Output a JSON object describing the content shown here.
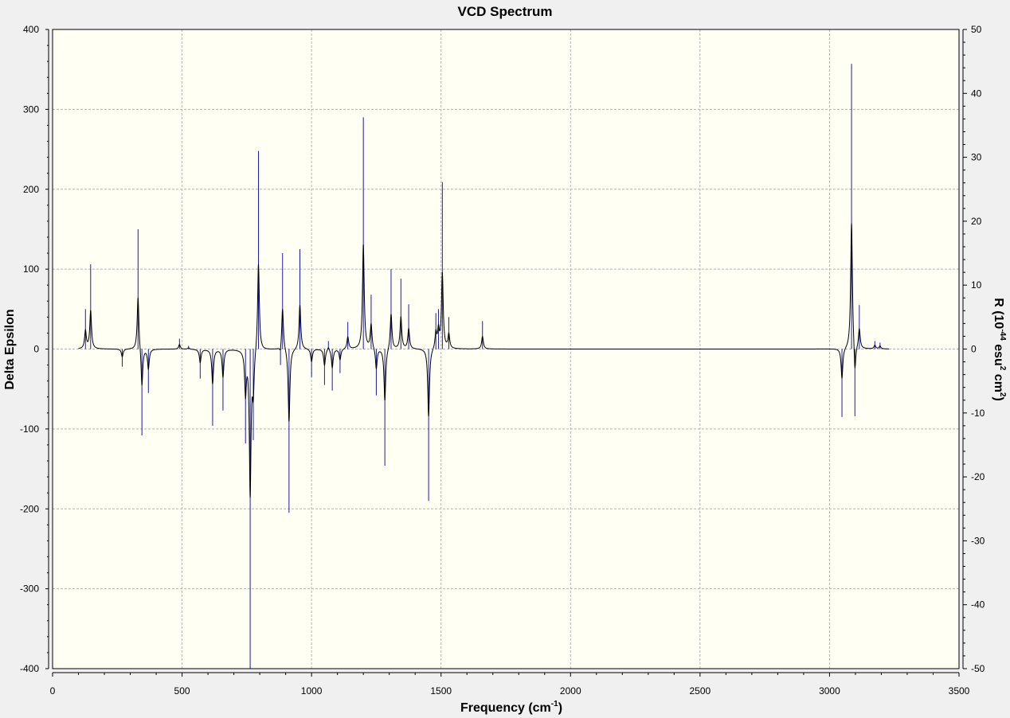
{
  "chart_data": {
    "type": "line",
    "title": "VCD Spectrum",
    "xlabel": {
      "main": "Frequency (cm",
      "sup": "-1",
      "tail": ")"
    },
    "ylabel_left": "Delta Epsilon",
    "ylabel_right": {
      "parts": [
        {
          "text": "R (10",
          "sup": false
        },
        {
          "text": "-44",
          "sup": true
        },
        {
          "text": " esu",
          "sup": false
        },
        {
          "text": "2",
          "sup": true
        },
        {
          "text": " cm",
          "sup": false
        },
        {
          "text": "2",
          "sup": true
        },
        {
          "text": ")",
          "sup": false
        }
      ]
    },
    "xlim": [
      0,
      3500
    ],
    "ylim_left": [
      -400,
      400
    ],
    "ylim_right": [
      -50,
      50
    ],
    "x_ticks": [
      0,
      500,
      1000,
      1500,
      2000,
      2500,
      3000,
      3500
    ],
    "y_ticks_left": [
      -400,
      -300,
      -200,
      -100,
      0,
      100,
      200,
      300,
      400
    ],
    "y_ticks_right": [
      -50,
      -40,
      -30,
      -20,
      -10,
      0,
      10,
      20,
      30,
      40,
      50
    ],
    "grid": true,
    "colors": {
      "plot_bg": "#fffff4",
      "grid": "#b4b4b4",
      "curve": "#000000",
      "sticks": "#1c1caa",
      "frame": "#000000"
    },
    "curve_range": [
      100,
      3230
    ],
    "curve_hwhm": 4,
    "series": [
      {
        "name": "",
        "kind": "sticks",
        "points": [
          [
            127,
            50
          ],
          [
            147,
            106
          ],
          [
            269,
            -22
          ],
          [
            330,
            150
          ],
          [
            345,
            -108
          ],
          [
            370,
            -55
          ],
          [
            490,
            13
          ],
          [
            525,
            4
          ],
          [
            570,
            -37
          ],
          [
            618,
            -96
          ],
          [
            658,
            -77
          ],
          [
            745,
            -118
          ],
          [
            763,
            -400
          ],
          [
            775,
            -114
          ],
          [
            795,
            248
          ],
          [
            880,
            -20
          ],
          [
            888,
            120
          ],
          [
            913,
            -205
          ],
          [
            955,
            125
          ],
          [
            1000,
            -35
          ],
          [
            1050,
            -45
          ],
          [
            1065,
            10
          ],
          [
            1080,
            -52
          ],
          [
            1110,
            -30
          ],
          [
            1140,
            34
          ],
          [
            1200,
            290
          ],
          [
            1230,
            68
          ],
          [
            1250,
            -58
          ],
          [
            1283,
            -146
          ],
          [
            1307,
            100
          ],
          [
            1345,
            88
          ],
          [
            1375,
            56
          ],
          [
            1452,
            -190
          ],
          [
            1480,
            45
          ],
          [
            1490,
            50
          ],
          [
            1505,
            209
          ],
          [
            1530,
            40
          ],
          [
            1660,
            35
          ],
          [
            3048,
            -85
          ],
          [
            3085,
            357
          ],
          [
            3098,
            -84
          ],
          [
            3115,
            55
          ],
          [
            3175,
            10
          ],
          [
            3195,
            8
          ]
        ]
      }
    ]
  }
}
